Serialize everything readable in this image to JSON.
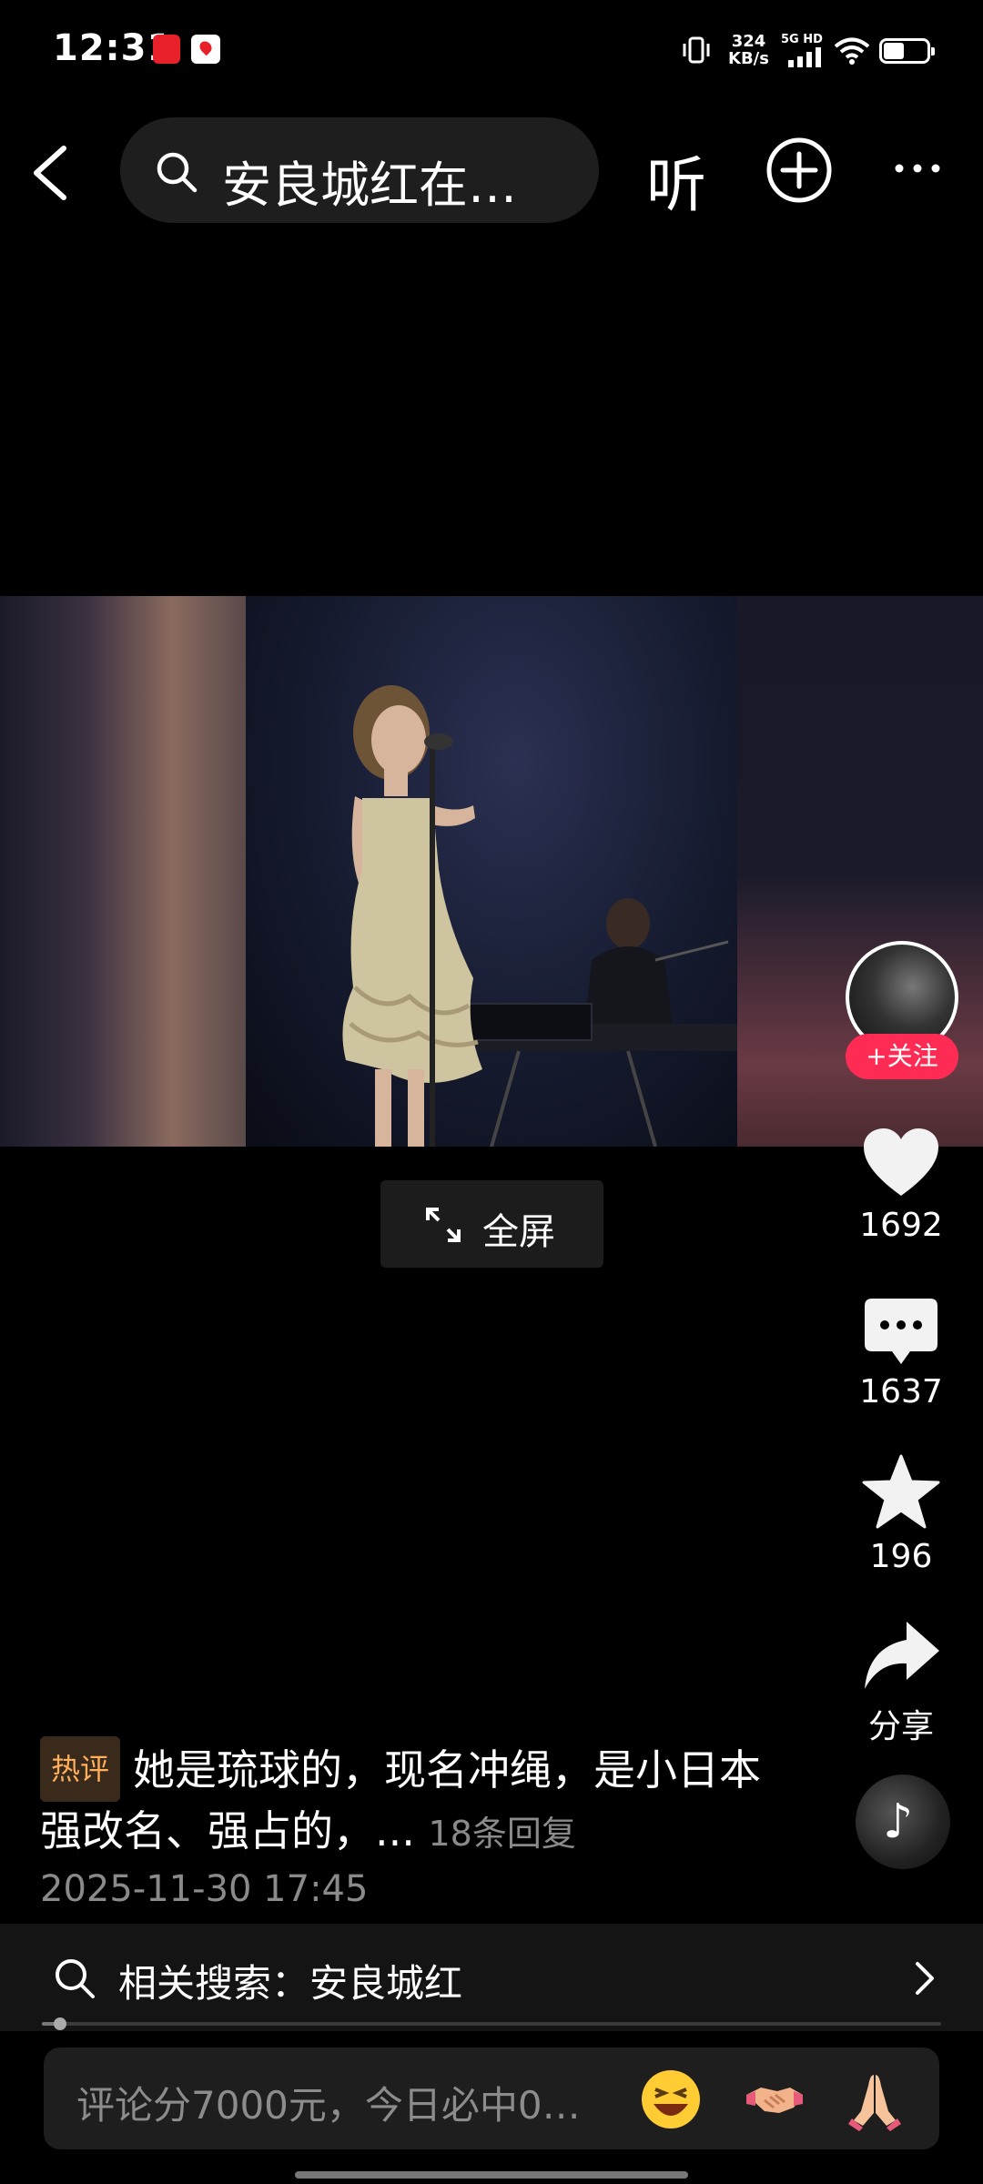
{
  "status_bar": {
    "time": "12:31",
    "network_speed_value": "324",
    "network_speed_unit": "KB/s",
    "network_type": "5G HD",
    "app_icons": [
      "news-app-icon",
      "map-app-icon"
    ]
  },
  "nav": {
    "search_text": "安良城红在…",
    "listen_label": "听"
  },
  "video": {
    "fullscreen_label": "全屏"
  },
  "actions": {
    "follow_label": "+关注",
    "likes": "1692",
    "comments": "1637",
    "favorites": "196",
    "share_label": "分享"
  },
  "hot_comment": {
    "tag": "热评",
    "text": "她是琉球的，现名冲绳，是小日本强改名、强占的，...",
    "replies": "18条回复",
    "date": "2025-11-30 17:45"
  },
  "related_search": {
    "text": "相关搜索：安良城红"
  },
  "comment_input": {
    "placeholder": "评论分7000元，今日必中0…",
    "emojis": [
      "laughing-emoji",
      "handshake-emoji",
      "praying-hands-emoji"
    ]
  },
  "colors": {
    "follow_red": "#fe2c55",
    "hot_tag_orange": "#ffae5a"
  },
  "video_progress": 0.02
}
